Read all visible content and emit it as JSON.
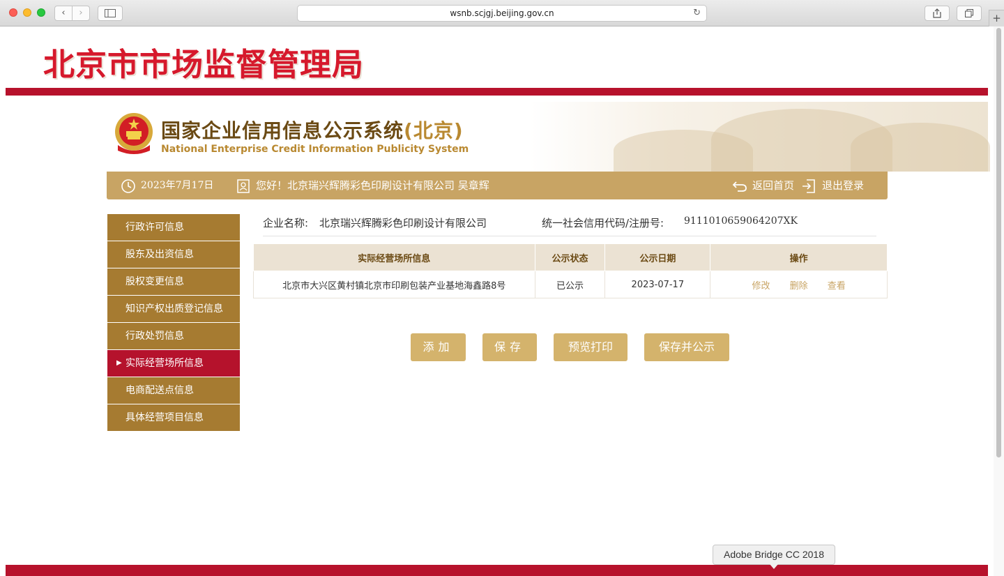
{
  "browser": {
    "url": "wsnb.scjgj.beijing.gov.cn",
    "back_icon": "‹",
    "forward_icon": "›",
    "new_tab_icon": "+"
  },
  "header": {
    "bureau_title": "北京市市场监督管理局",
    "system_title_main": "国家企业信用信息公示系统",
    "system_title_region": "(北京)",
    "system_title_en": "National Enterprise Credit Information Publicity System"
  },
  "info_bar": {
    "date": "2023年7月17日",
    "greeting": "您好！北京瑞兴辉腾彩色印刷设计有限公司  吴章辉",
    "home_link": "返回首页",
    "logout_link": "退出登录"
  },
  "menu": {
    "items": [
      {
        "label": "行政许可信息"
      },
      {
        "label": "股东及出资信息"
      },
      {
        "label": "股权变更信息"
      },
      {
        "label": "知识产权出质登记信息"
      },
      {
        "label": "行政处罚信息"
      },
      {
        "label": "实际经营场所信息"
      },
      {
        "label": "电商配送点信息"
      },
      {
        "label": "具体经营项目信息"
      }
    ],
    "active_index": 5
  },
  "company": {
    "name_label": "企业名称:",
    "name": "北京瑞兴辉腾彩色印刷设计有限公司",
    "credit_label": "统一社会信用代码/注册号:",
    "credit_code": "9111010659064207XK"
  },
  "table": {
    "headers": [
      "实际经营场所信息",
      "公示状态",
      "公示日期",
      "操作"
    ],
    "rows": [
      {
        "address": "北京市大兴区黄村镇北京市印刷包装产业基地海鑫路8号",
        "status": "已公示",
        "date": "2023-07-17",
        "ops": [
          "修改",
          "删除",
          "查看"
        ]
      }
    ]
  },
  "buttons": {
    "add": "添加",
    "save": "保存",
    "preview_print": "预览打印",
    "save_publish": "保存并公示"
  },
  "tooltip": {
    "text": "Adobe Bridge CC 2018"
  },
  "colors": {
    "brand_red": "#b7122c",
    "gold": "#c8a464",
    "menu_brown": "#a67b31"
  }
}
